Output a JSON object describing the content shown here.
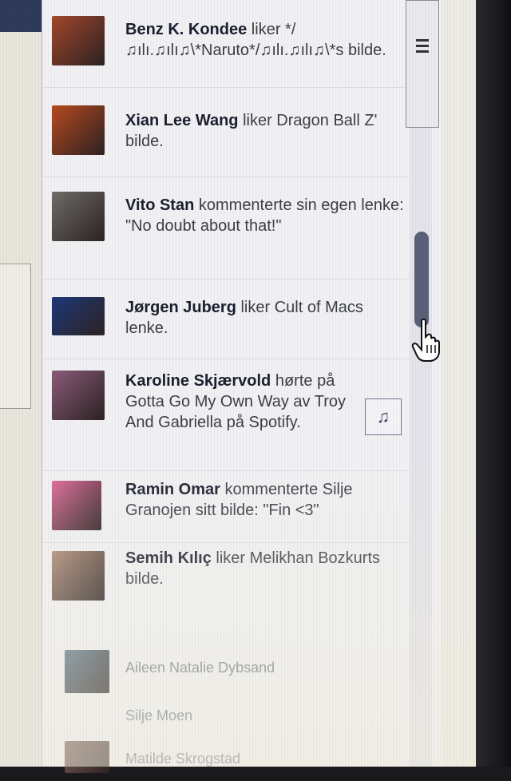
{
  "ticker": {
    "stories": [
      {
        "actor": "Benz K. Kondee",
        "text": " liker */♫ılı.♫ılı♫\\*Naruto*/♫ılı.♫ılı♫\\*s bilde.",
        "avatar_color": "#a4472b"
      },
      {
        "actor": "Xian Lee Wang",
        "text": " liker Dragon Ball Z' bilde.",
        "avatar_color": "#b84a1f"
      },
      {
        "actor": "Vito Stan",
        "text": " kommenterte sin egen lenke: \"No doubt about that!\"",
        "avatar_color": "#6f6c69"
      },
      {
        "actor": "Jørgen Juberg",
        "text": " liker Cult of Macs lenke.",
        "avatar_color": "#1e3978"
      },
      {
        "actor": "Karoline Skjærvold",
        "text": " hørte på Gotta Go My Own Way av Troy And Gabriella på Spotify.",
        "avatar_color": "#8b5b7a"
      },
      {
        "actor": "Ramin Omar",
        "text": " kommenterte Silje Granojen sitt bilde: \"Fin <3\"",
        "avatar_color": "#e06a9a"
      },
      {
        "actor": "Semih Kılıç",
        "text": " liker Melikhan Bozkurts bilde.",
        "avatar_color": "#b08c78"
      }
    ]
  },
  "chat": {
    "contacts": [
      {
        "name": "Aileen Natalie Dybsand",
        "avatar_color": "#5d7a8e"
      },
      {
        "name": "Silje Moen",
        "avatar_color": ""
      },
      {
        "name": "Matilde Skrogstad",
        "avatar_color": "#7d5b55"
      }
    ]
  },
  "icons": {
    "menu": "menu-lines-icon",
    "music": "music-note-icon",
    "cursor": "hand-pointer-icon"
  }
}
